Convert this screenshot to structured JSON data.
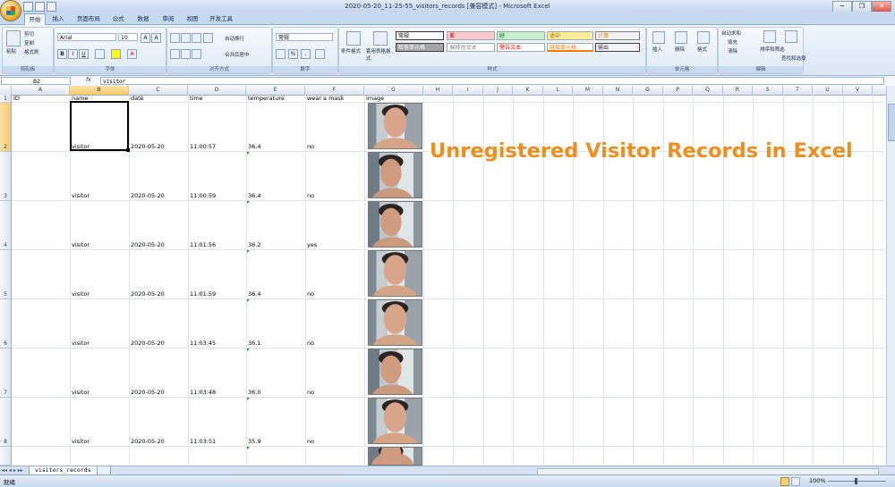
{
  "window": {
    "title": "2020-05-20_11-25-55_visitors_records  [兼容模式] - Microsoft Excel",
    "controls": [
      "─",
      "❐",
      "✕"
    ]
  },
  "ribbon_tabs": [
    "开始",
    "插入",
    "页面布局",
    "公式",
    "数据",
    "审阅",
    "视图",
    "开发工具"
  ],
  "ribbon": {
    "clipboard": {
      "paste": "粘贴",
      "cut": "剪切",
      "copy": "复制",
      "format_painter": "格式刷",
      "label": "剪贴板"
    },
    "font": {
      "name": "Arial",
      "size": "10",
      "label": "字体"
    },
    "alignment": {
      "wrap": "自动换行",
      "merge": "合并后居中",
      "label": "对齐方式"
    },
    "number": {
      "format": "常规",
      "label": "数字"
    },
    "styles": {
      "conditional": "条件格式",
      "table": "套用表格格式",
      "cells": [
        {
          "text": "常规",
          "bg": "#ffffff",
          "fg": "#000000"
        },
        {
          "text": "差",
          "bg": "#ffc7ce",
          "fg": "#9c0006"
        },
        {
          "text": "好",
          "bg": "#c6efce",
          "fg": "#006100"
        },
        {
          "text": "适中",
          "bg": "#ffeb9c",
          "fg": "#9c6500"
        },
        {
          "text": "计算",
          "bg": "#f2f2f2",
          "fg": "#fa7d00"
        },
        {
          "text": "检查单元格",
          "bg": "#a5a5a5",
          "fg": "#ffffff"
        },
        {
          "text": "解释性文本",
          "bg": "#ffffff",
          "fg": "#7f7f7f"
        },
        {
          "text": "警告文本",
          "bg": "#ffffff",
          "fg": "#ff0000"
        },
        {
          "text": "链接单元格",
          "bg": "#ffffff",
          "fg": "#fa7d00"
        },
        {
          "text": "输出",
          "bg": "#f2f2f2",
          "fg": "#3f3f3f"
        }
      ],
      "label": "样式"
    },
    "cells_group": {
      "insert": "插入",
      "delete": "删除",
      "format": "格式",
      "label": "单元格"
    },
    "editing": {
      "autosum": "自动求和",
      "fill": "填充",
      "clear": "清除",
      "sort": "排序和筛选",
      "find": "查找和选择",
      "label": "编辑"
    }
  },
  "formula_bar": {
    "name_box": "B2",
    "fx": "fx",
    "content": "visitor"
  },
  "columns": [
    "A",
    "B",
    "C",
    "D",
    "E",
    "F",
    "G",
    "H",
    "I",
    "J",
    "K",
    "L",
    "M",
    "N",
    "O",
    "P",
    "Q",
    "R",
    "S",
    "T",
    "U",
    "V"
  ],
  "selected_column": "B",
  "headers": {
    "A": "ID",
    "B": "name",
    "C": "date",
    "D": "time",
    "E": "temperature",
    "F": "wear a mask",
    "G": "image"
  },
  "rows": [
    {
      "num": "2",
      "name": "visitor",
      "date": "2020-05-20",
      "time": "11:00:57",
      "temperature": "36.4",
      "mask": "no"
    },
    {
      "num": "3",
      "name": "visitor",
      "date": "2020-05-20",
      "time": "11:00:59",
      "temperature": "36.4",
      "mask": "no"
    },
    {
      "num": "4",
      "name": "visitor",
      "date": "2020-05-20",
      "time": "11:01:56",
      "temperature": "36.2",
      "mask": "yes"
    },
    {
      "num": "5",
      "name": "visitor",
      "date": "2020-05-20",
      "time": "11:01:59",
      "temperature": "36.4",
      "mask": "no"
    },
    {
      "num": "6",
      "name": "visitor",
      "date": "2020-05-20",
      "time": "11:03:45",
      "temperature": "36.1",
      "mask": "no"
    },
    {
      "num": "7",
      "name": "visitor",
      "date": "2020-05-20",
      "time": "11:03:48",
      "temperature": "36.0",
      "mask": "no"
    },
    {
      "num": "8",
      "name": "visitor",
      "date": "2020-05-20",
      "time": "11:03:51",
      "temperature": "35.9",
      "mask": "no"
    }
  ],
  "header_row_num": "1",
  "overlay_title": "Unregistered Visitor Records in Excel",
  "sheet_tab": "visitors_records",
  "status": {
    "ready": "就绪",
    "zoom": "100%"
  },
  "colors": {
    "accent": "#ef8e1c",
    "selection": "#f5c86a",
    "ribbon": "#dbe7f6"
  }
}
